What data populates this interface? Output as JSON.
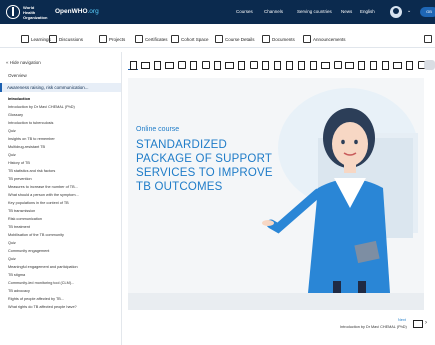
{
  "header": {
    "org_name": "World Health Organization",
    "site_name": "OpenWHO",
    "site_suffix": ".org",
    "nav": [
      "Courses",
      "Channels",
      "Serving countries",
      "News",
      "English"
    ],
    "user_badge": "GB"
  },
  "toolbar": {
    "items": [
      "Learnings",
      "Discussions",
      "Projects",
      "Certificates",
      "Cohort Space",
      "Course Details",
      "Documents",
      "Announcements"
    ]
  },
  "sidebar": {
    "hide_label": "Hide navigation",
    "overview": "Overview",
    "section": "Awareness raising, risk communication...",
    "lessons": [
      "Introduction",
      "Introduction by Dr Mavi CHEMAL (PhD)",
      "Glossary",
      "Introduction to tuberculosis",
      "Quiz",
      "Insights on TB to remember",
      "Multidrug-resistant TB",
      "Quiz",
      "History of TB",
      "TB statistics and risk factors",
      "TB prevention",
      "Measures to increase the number of TB...",
      "What should a person with the symptom...",
      "Key populations in the context of TB",
      "TB transmission",
      "Risk communication",
      "TB treatment",
      "Mobilisation of the TB community",
      "Quiz",
      "Community engagement",
      "Quiz",
      "Meaningful engagement and participation",
      "TB stigma",
      "Community-led monitoring tool (CLM)...",
      "TB advocacy",
      "Rights of people affected by TB...",
      "What rights do TB affected people have?"
    ]
  },
  "slide": {
    "kicker": "Online course",
    "title": "Standardized package of support services to improve TB outcomes"
  },
  "footer": {
    "next": "Next",
    "author": "Introduction by Dr Mavi CHEMAL (PhD)"
  },
  "colors": {
    "header_bg": "#0b2a4e",
    "accent": "#1f7cc8"
  }
}
